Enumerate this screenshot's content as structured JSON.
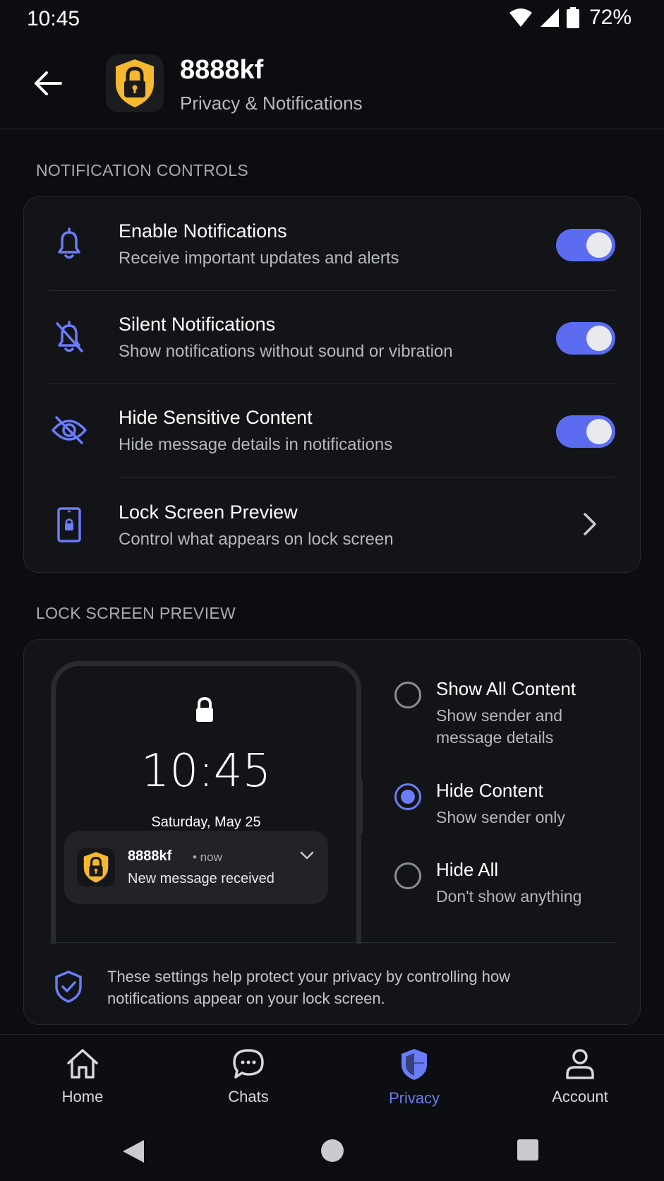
{
  "status_bar": {
    "time": "10:45",
    "battery": "72%"
  },
  "header": {
    "app_name": "8888kf",
    "subtitle": "Privacy & Notifications"
  },
  "notification_controls": {
    "section_label": "NOTIFICATION CONTROLS",
    "rows": [
      {
        "title": "Enable Notifications",
        "desc": "Receive important updates and alerts",
        "icon": "bell-icon",
        "toggle_on": true
      },
      {
        "title": "Silent Notifications",
        "desc": "Show notifications without sound or vibration",
        "icon": "bell-off-icon",
        "toggle_on": true
      },
      {
        "title": "Hide Sensitive Content",
        "desc": "Hide message details in notifications",
        "icon": "eye-off-icon",
        "toggle_on": true
      },
      {
        "title": "Lock Screen Preview",
        "desc": "Control what appears on lock screen",
        "icon": "phone-lock-icon"
      }
    ]
  },
  "lock_screen_preview": {
    "section_label": "LOCK SCREEN PREVIEW",
    "phone": {
      "time": "10:45",
      "date": "Saturday, May 25",
      "notification": {
        "app": "8888kf",
        "time": "• now",
        "message": "New message received"
      }
    },
    "options": [
      {
        "title": "Show All Content",
        "desc": "Show sender and message details",
        "selected": false
      },
      {
        "title": "Hide Content",
        "desc": "Show sender only",
        "selected": true
      },
      {
        "title": "Hide All",
        "desc": "Don't show anything",
        "selected": false
      }
    ],
    "info": "These settings help protect your privacy by controlling how notifications appear on your lock screen."
  },
  "bottom_nav": {
    "items": [
      {
        "label": "Home",
        "icon": "home-icon"
      },
      {
        "label": "Chats",
        "icon": "chat-icon"
      },
      {
        "label": "Privacy",
        "icon": "shield-icon",
        "active": true
      },
      {
        "label": "Account",
        "icon": "person-icon"
      }
    ]
  },
  "colors": {
    "accent": "#5b6cf0",
    "background": "#0c0d10",
    "card": "#131418",
    "lock_yellow": "#f5b82e"
  }
}
